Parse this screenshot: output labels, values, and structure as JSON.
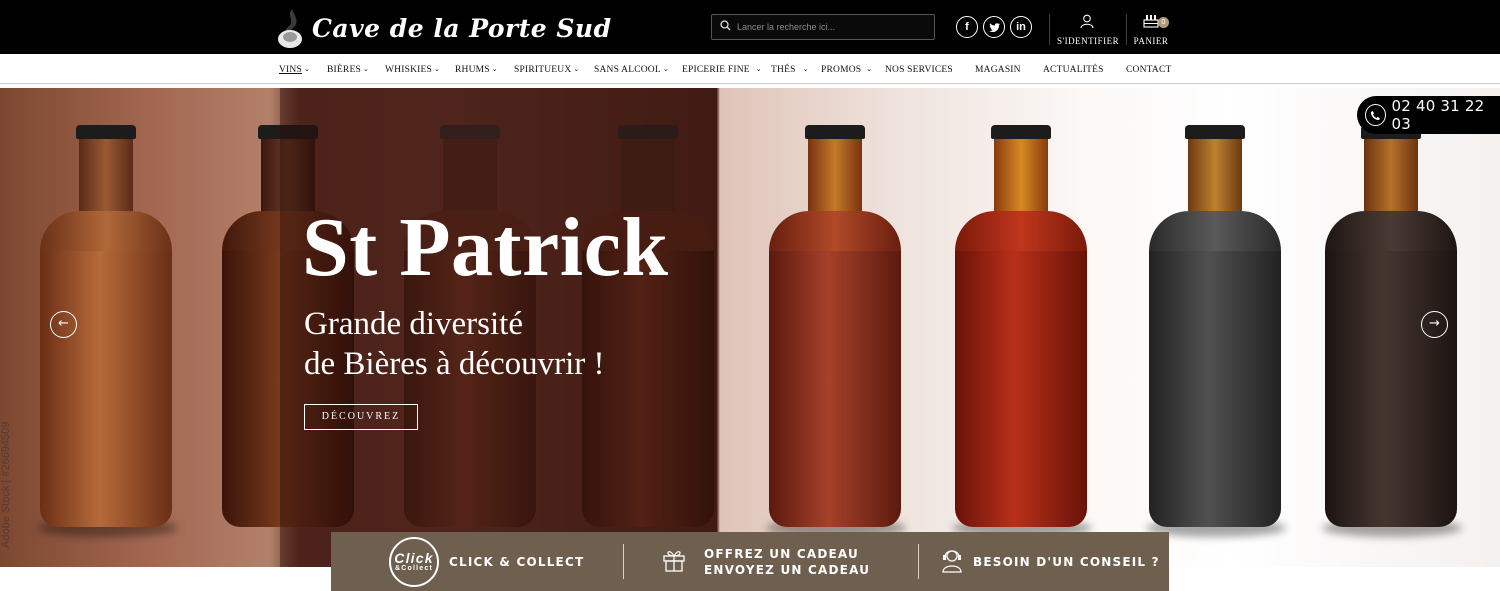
{
  "header": {
    "logo_text": "Cave de la Porte Sud",
    "search": {
      "placeholder": "Lancer la recherche ici..."
    },
    "social": [
      {
        "icon": "facebook-icon",
        "glyph": "f"
      },
      {
        "icon": "twitter-icon",
        "glyph": "t"
      },
      {
        "icon": "linkedin-icon",
        "glyph": "in"
      }
    ],
    "account_label": "S'IDENTIFIER",
    "cart_label": "PANIER",
    "cart_count": "0"
  },
  "nav": {
    "items": [
      {
        "label": "VINS",
        "has_dropdown": true,
        "active": true
      },
      {
        "label": "BIÈRES",
        "has_dropdown": true
      },
      {
        "label": "WHISKIES",
        "has_dropdown": true
      },
      {
        "label": "RHUMS",
        "has_dropdown": true
      },
      {
        "label": "SPIRITUEUX",
        "has_dropdown": true
      },
      {
        "label": "SANS ALCOOL",
        "has_dropdown": true
      },
      {
        "label": "EPICERIE FINE",
        "has_dropdown": true
      },
      {
        "label": "THÉS",
        "has_dropdown": true
      },
      {
        "label": "PROMOS",
        "has_dropdown": true
      },
      {
        "label": "NOS SERVICES",
        "has_dropdown": false
      },
      {
        "label": "MAGASIN",
        "has_dropdown": false
      },
      {
        "label": "ACTUALITÉS",
        "has_dropdown": false
      },
      {
        "label": "CONTACT",
        "has_dropdown": false
      }
    ]
  },
  "hero": {
    "title": "St Patrick",
    "subtitle_line1": "Grande diversité",
    "subtitle_line2": "de Bières à découvrir !",
    "button_label": "DÉCOUVREZ",
    "prev_arrow": "←",
    "next_arrow": "→",
    "watermark": "Adobe Stock | #26694509"
  },
  "phone": {
    "number": "02 40 31 22 03"
  },
  "services": {
    "click_collect_badge_top": "Click",
    "click_collect_badge_bottom": "&Collect",
    "click_collect_label": "CLICK & COLLECT",
    "gift_line1": "OFFREZ UN CADEAU",
    "gift_line2": "ENVOYEZ UN CADEAU",
    "advice_label": "BESOIN D'UN CONSEIL ?"
  },
  "colors": {
    "topbar": "#000000",
    "services_bar": "#6f5f4f",
    "cart_badge": "#b39b7a"
  }
}
